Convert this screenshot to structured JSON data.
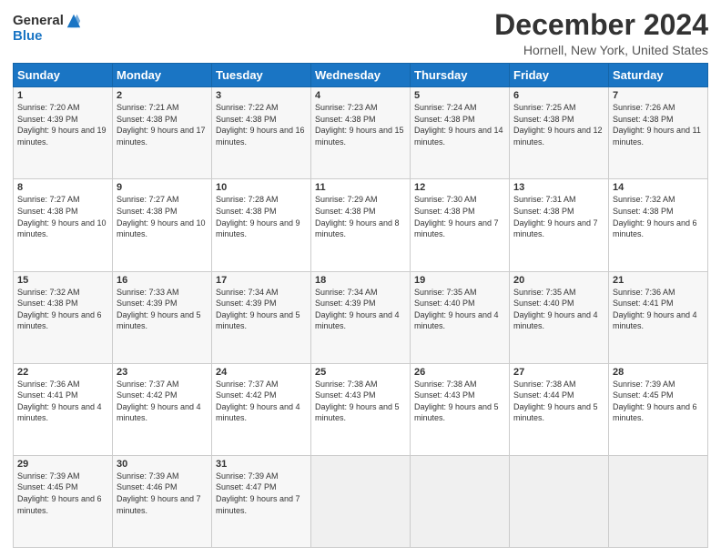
{
  "header": {
    "logo_line1": "General",
    "logo_line2": "Blue",
    "title": "December 2024",
    "subtitle": "Hornell, New York, United States"
  },
  "weekdays": [
    "Sunday",
    "Monday",
    "Tuesday",
    "Wednesday",
    "Thursday",
    "Friday",
    "Saturday"
  ],
  "weeks": [
    [
      {
        "day": "1",
        "sunrise": "Sunrise: 7:20 AM",
        "sunset": "Sunset: 4:39 PM",
        "daylight": "Daylight: 9 hours and 19 minutes."
      },
      {
        "day": "2",
        "sunrise": "Sunrise: 7:21 AM",
        "sunset": "Sunset: 4:38 PM",
        "daylight": "Daylight: 9 hours and 17 minutes."
      },
      {
        "day": "3",
        "sunrise": "Sunrise: 7:22 AM",
        "sunset": "Sunset: 4:38 PM",
        "daylight": "Daylight: 9 hours and 16 minutes."
      },
      {
        "day": "4",
        "sunrise": "Sunrise: 7:23 AM",
        "sunset": "Sunset: 4:38 PM",
        "daylight": "Daylight: 9 hours and 15 minutes."
      },
      {
        "day": "5",
        "sunrise": "Sunrise: 7:24 AM",
        "sunset": "Sunset: 4:38 PM",
        "daylight": "Daylight: 9 hours and 14 minutes."
      },
      {
        "day": "6",
        "sunrise": "Sunrise: 7:25 AM",
        "sunset": "Sunset: 4:38 PM",
        "daylight": "Daylight: 9 hours and 12 minutes."
      },
      {
        "day": "7",
        "sunrise": "Sunrise: 7:26 AM",
        "sunset": "Sunset: 4:38 PM",
        "daylight": "Daylight: 9 hours and 11 minutes."
      }
    ],
    [
      {
        "day": "8",
        "sunrise": "Sunrise: 7:27 AM",
        "sunset": "Sunset: 4:38 PM",
        "daylight": "Daylight: 9 hours and 10 minutes."
      },
      {
        "day": "9",
        "sunrise": "Sunrise: 7:27 AM",
        "sunset": "Sunset: 4:38 PM",
        "daylight": "Daylight: 9 hours and 10 minutes."
      },
      {
        "day": "10",
        "sunrise": "Sunrise: 7:28 AM",
        "sunset": "Sunset: 4:38 PM",
        "daylight": "Daylight: 9 hours and 9 minutes."
      },
      {
        "day": "11",
        "sunrise": "Sunrise: 7:29 AM",
        "sunset": "Sunset: 4:38 PM",
        "daylight": "Daylight: 9 hours and 8 minutes."
      },
      {
        "day": "12",
        "sunrise": "Sunrise: 7:30 AM",
        "sunset": "Sunset: 4:38 PM",
        "daylight": "Daylight: 9 hours and 7 minutes."
      },
      {
        "day": "13",
        "sunrise": "Sunrise: 7:31 AM",
        "sunset": "Sunset: 4:38 PM",
        "daylight": "Daylight: 9 hours and 7 minutes."
      },
      {
        "day": "14",
        "sunrise": "Sunrise: 7:32 AM",
        "sunset": "Sunset: 4:38 PM",
        "daylight": "Daylight: 9 hours and 6 minutes."
      }
    ],
    [
      {
        "day": "15",
        "sunrise": "Sunrise: 7:32 AM",
        "sunset": "Sunset: 4:38 PM",
        "daylight": "Daylight: 9 hours and 6 minutes."
      },
      {
        "day": "16",
        "sunrise": "Sunrise: 7:33 AM",
        "sunset": "Sunset: 4:39 PM",
        "daylight": "Daylight: 9 hours and 5 minutes."
      },
      {
        "day": "17",
        "sunrise": "Sunrise: 7:34 AM",
        "sunset": "Sunset: 4:39 PM",
        "daylight": "Daylight: 9 hours and 5 minutes."
      },
      {
        "day": "18",
        "sunrise": "Sunrise: 7:34 AM",
        "sunset": "Sunset: 4:39 PM",
        "daylight": "Daylight: 9 hours and 4 minutes."
      },
      {
        "day": "19",
        "sunrise": "Sunrise: 7:35 AM",
        "sunset": "Sunset: 4:40 PM",
        "daylight": "Daylight: 9 hours and 4 minutes."
      },
      {
        "day": "20",
        "sunrise": "Sunrise: 7:35 AM",
        "sunset": "Sunset: 4:40 PM",
        "daylight": "Daylight: 9 hours and 4 minutes."
      },
      {
        "day": "21",
        "sunrise": "Sunrise: 7:36 AM",
        "sunset": "Sunset: 4:41 PM",
        "daylight": "Daylight: 9 hours and 4 minutes."
      }
    ],
    [
      {
        "day": "22",
        "sunrise": "Sunrise: 7:36 AM",
        "sunset": "Sunset: 4:41 PM",
        "daylight": "Daylight: 9 hours and 4 minutes."
      },
      {
        "day": "23",
        "sunrise": "Sunrise: 7:37 AM",
        "sunset": "Sunset: 4:42 PM",
        "daylight": "Daylight: 9 hours and 4 minutes."
      },
      {
        "day": "24",
        "sunrise": "Sunrise: 7:37 AM",
        "sunset": "Sunset: 4:42 PM",
        "daylight": "Daylight: 9 hours and 4 minutes."
      },
      {
        "day": "25",
        "sunrise": "Sunrise: 7:38 AM",
        "sunset": "Sunset: 4:43 PM",
        "daylight": "Daylight: 9 hours and 5 minutes."
      },
      {
        "day": "26",
        "sunrise": "Sunrise: 7:38 AM",
        "sunset": "Sunset: 4:43 PM",
        "daylight": "Daylight: 9 hours and 5 minutes."
      },
      {
        "day": "27",
        "sunrise": "Sunrise: 7:38 AM",
        "sunset": "Sunset: 4:44 PM",
        "daylight": "Daylight: 9 hours and 5 minutes."
      },
      {
        "day": "28",
        "sunrise": "Sunrise: 7:39 AM",
        "sunset": "Sunset: 4:45 PM",
        "daylight": "Daylight: 9 hours and 6 minutes."
      }
    ],
    [
      {
        "day": "29",
        "sunrise": "Sunrise: 7:39 AM",
        "sunset": "Sunset: 4:45 PM",
        "daylight": "Daylight: 9 hours and 6 minutes."
      },
      {
        "day": "30",
        "sunrise": "Sunrise: 7:39 AM",
        "sunset": "Sunset: 4:46 PM",
        "daylight": "Daylight: 9 hours and 7 minutes."
      },
      {
        "day": "31",
        "sunrise": "Sunrise: 7:39 AM",
        "sunset": "Sunset: 4:47 PM",
        "daylight": "Daylight: 9 hours and 7 minutes."
      },
      null,
      null,
      null,
      null
    ]
  ]
}
